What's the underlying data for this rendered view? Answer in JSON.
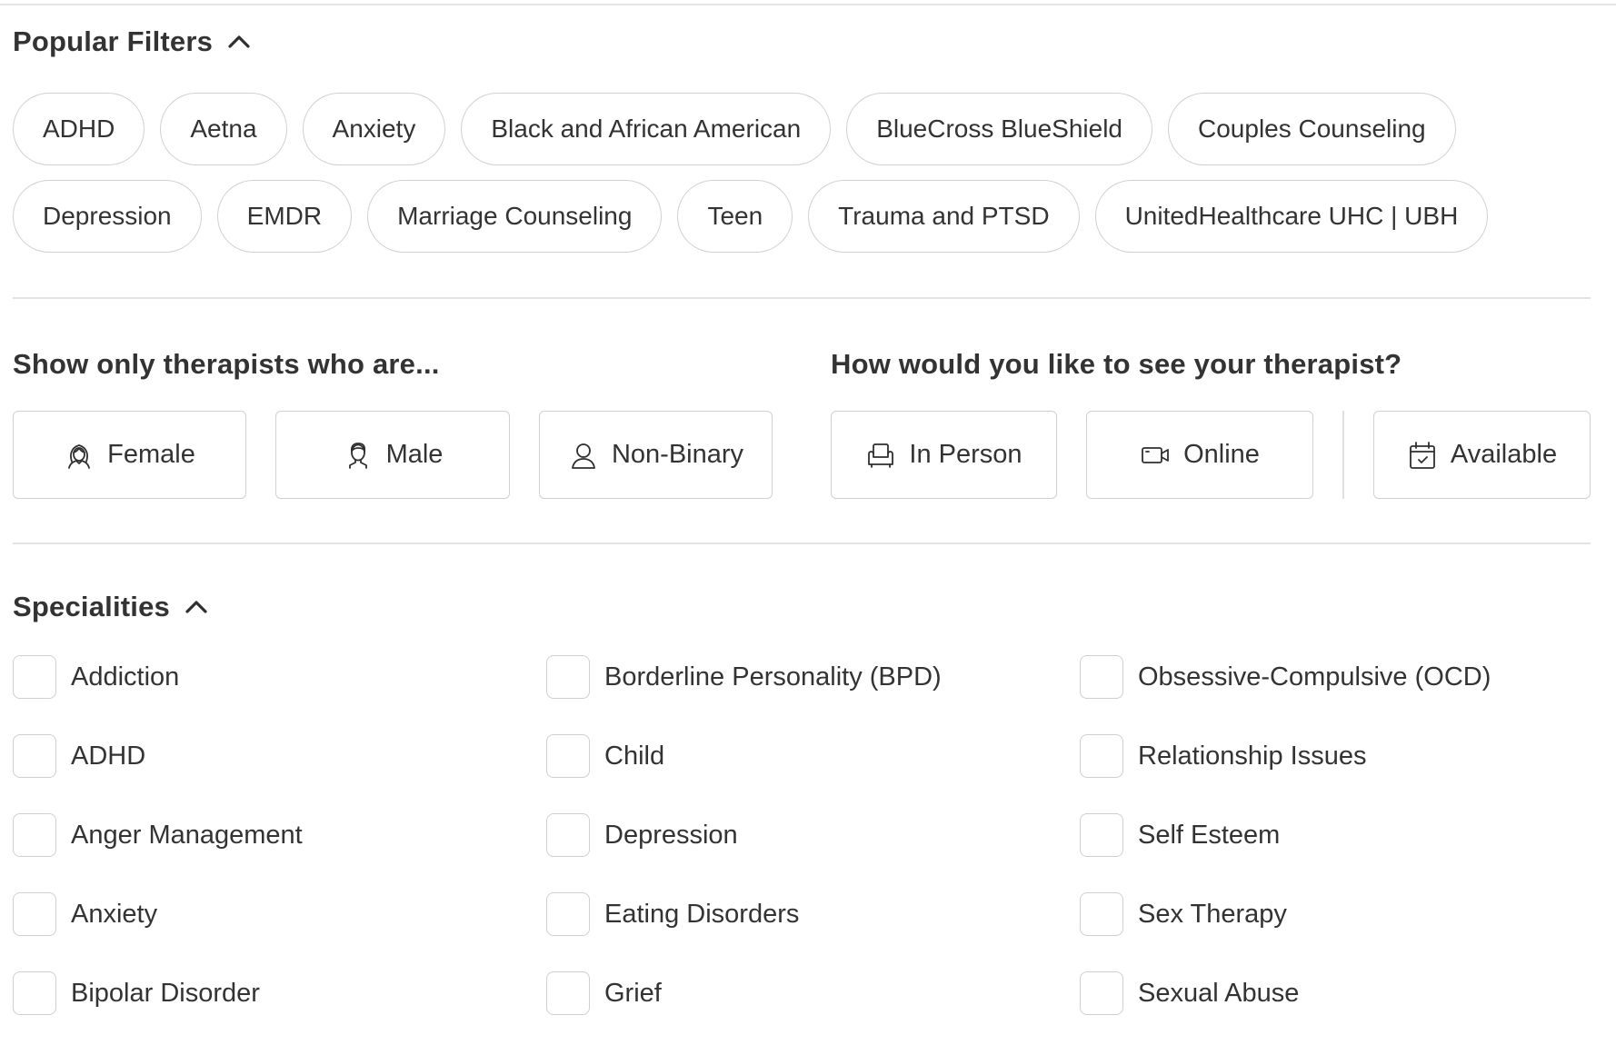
{
  "popular_filters": {
    "title": "Popular Filters",
    "toggle_icon": "chevron-up-icon",
    "row1": [
      "ADHD",
      "Aetna",
      "Anxiety",
      "Black and African American",
      "BlueCross BlueShield",
      "Couples Counseling"
    ],
    "row2": [
      "Depression",
      "EMDR",
      "Marriage Counseling",
      "Teen",
      "Trauma and PTSD",
      "UnitedHealthcare UHC | UBH"
    ]
  },
  "therapist_gender": {
    "title": "Show only therapists who are...",
    "options": [
      {
        "label": "Female",
        "icon": "female-icon"
      },
      {
        "label": "Male",
        "icon": "male-icon"
      },
      {
        "label": "Non-Binary",
        "icon": "person-icon"
      }
    ]
  },
  "session_type": {
    "title": "How would you like to see your therapist?",
    "options": [
      {
        "label": "In Person",
        "icon": "armchair-icon"
      },
      {
        "label": "Online",
        "icon": "video-camera-icon"
      },
      {
        "label": "Available",
        "icon": "calendar-check-icon"
      }
    ]
  },
  "specialities": {
    "title": "Specialities",
    "toggle_icon": "chevron-up-icon",
    "col1": [
      "Addiction",
      "ADHD",
      "Anger Management",
      "Anxiety",
      "Bipolar Disorder"
    ],
    "col2": [
      "Borderline Personality (BPD)",
      "Child",
      "Depression",
      "Eating Disorders",
      "Grief"
    ],
    "col3": [
      "Obsessive-Compulsive (OCD)",
      "Relationship Issues",
      "Self Esteem",
      "Sex Therapy",
      "Sexual Abuse"
    ]
  },
  "colors": {
    "text": "#333333",
    "border": "#d0d0d0",
    "divider": "#e3e3e3"
  }
}
